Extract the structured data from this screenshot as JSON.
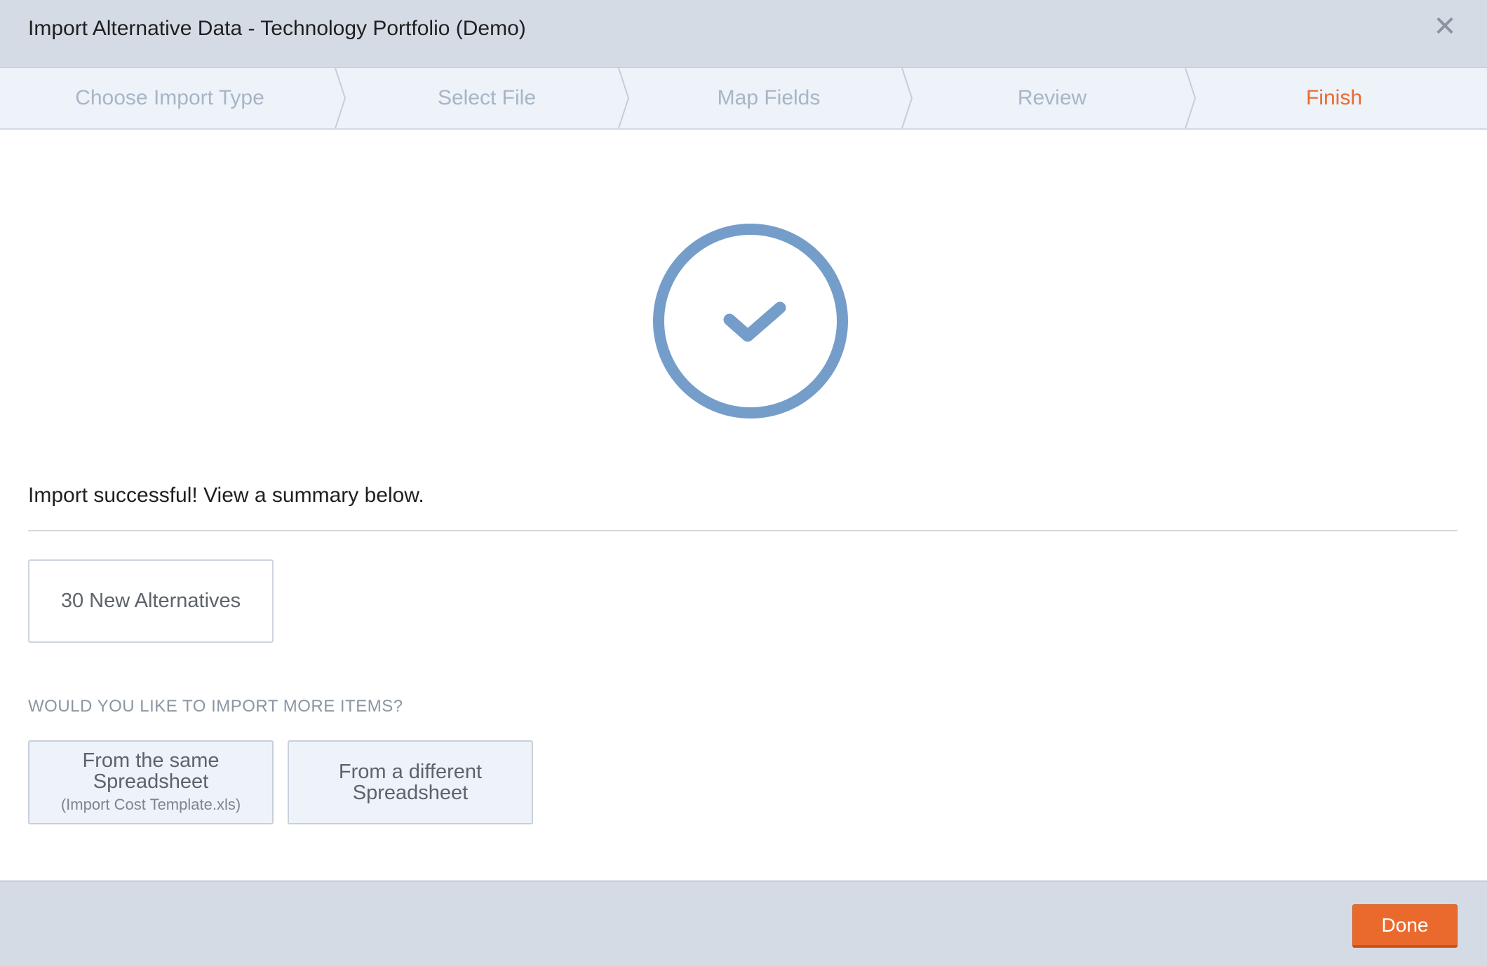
{
  "dialog": {
    "title": "Import Alternative Data - Technology Portfolio (Demo)",
    "close_icon": "close-icon",
    "close_glyph": "✕"
  },
  "steps": [
    {
      "label": "Choose Import Type",
      "state": "done"
    },
    {
      "label": "Select File",
      "state": "done"
    },
    {
      "label": "Map Fields",
      "state": "done"
    },
    {
      "label": "Review",
      "state": "done"
    },
    {
      "label": "Finish",
      "state": "active"
    }
  ],
  "result": {
    "icon": "check-circle-icon",
    "message": "Import successful! View a summary below.",
    "summary": "30 New Alternatives"
  },
  "more": {
    "prompt": "WOULD YOU LIKE TO IMPORT MORE ITEMS?",
    "same": {
      "line1": "From the same",
      "line2": "Spreadsheet",
      "file": "(Import Cost Template.xls)"
    },
    "different": {
      "line1": "From a different",
      "line2": "Spreadsheet"
    }
  },
  "footer": {
    "done_label": "Done"
  },
  "colors": {
    "accent": "#ea6a2e",
    "check": "#759dca",
    "header_bg": "#d4dbe5",
    "steps_bg": "#eef2f9"
  }
}
